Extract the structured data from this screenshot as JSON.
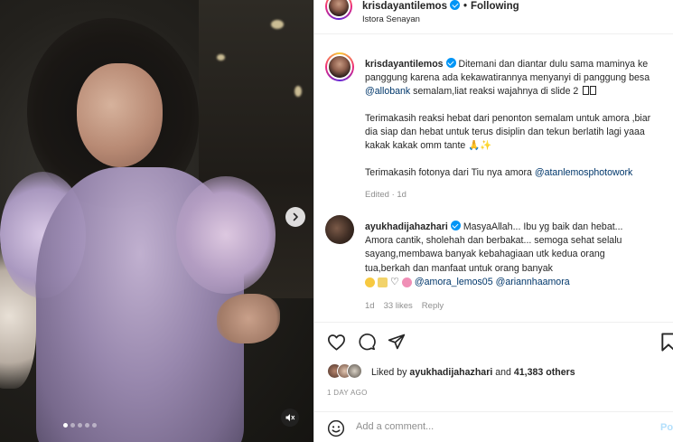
{
  "header": {
    "username": "krisdayantilemos",
    "separator": "•",
    "follow_label": "Following",
    "location": "Istora Senayan"
  },
  "caption": {
    "username": "krisdayantilemos",
    "lines": [
      "Ditemani dan diantar dulu sama maminya ke",
      "panggung karena ada kekawatirannya menyanyi di panggung besa",
      "semalam,liat reaksi wajahnya di slide 2 ",
      "Terimakasih reaksi hebat dari penonton semalam untuk amora ,biar",
      "dia siap dan hebat untuk terus disiplin dan tekun berlatih lagi yaaa",
      "kakak kakak omm tante 🙏✨",
      "Terimakasih fotonya dari Tiu nya amora"
    ],
    "mention_allobank": "@allobank",
    "mention_photographer": "@atanlemosphotowork",
    "edited": "Edited",
    "age": "1d"
  },
  "comment": {
    "username": "ayukhadijahazhari",
    "lines": [
      "MasyaAllah... Ibu yg baik dan hebat...",
      "Amora cantik, sholehah dan berbakat... semoga sehat selalu",
      "sayang,membawa banyak kebahagiaan utk kedua orang",
      "tua,berkah dan manfaat untuk orang banyak"
    ],
    "mention_1": "@amora_lemos05",
    "mention_2": "@ariannhaamora",
    "age": "1d",
    "likes": "33 likes",
    "reply": "Reply"
  },
  "likes": {
    "prefix": "Liked by",
    "user": "ayukhadijahazhari",
    "and": "and",
    "others": "41,383 others"
  },
  "date": "1 DAY AGO",
  "add_comment": {
    "placeholder": "Add a comment...",
    "post_label": "Post"
  },
  "media": {
    "slide_count": 5,
    "active_slide": 1
  },
  "colors": {
    "verified": "#0095f6",
    "mention": "#00376b",
    "post_button": "#b2dffc"
  },
  "icons": [
    "next-arrow-icon",
    "mute-icon",
    "heart-icon",
    "comment-icon",
    "share-icon",
    "bookmark-icon",
    "smile-icon",
    "verified-icon"
  ]
}
